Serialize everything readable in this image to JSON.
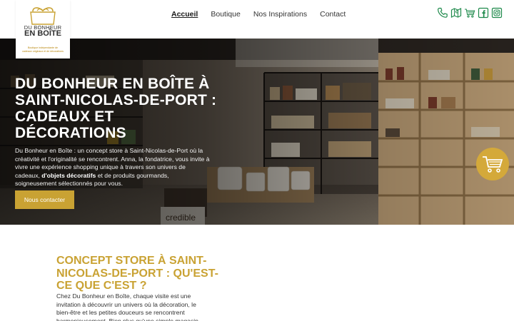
{
  "brand": {
    "logo_line1": "DU BONHEUR",
    "logo_line2": "EN BOÎTE",
    "logo_tagline1": "Boutique indépendante de",
    "logo_tagline2": "cadeaux originaux et de décorations",
    "accent_color": "#c9a233"
  },
  "nav": {
    "items": [
      {
        "label": "Accueil",
        "active": true
      },
      {
        "label": "Boutique",
        "active": false
      },
      {
        "label": "Nos Inspirations",
        "active": false
      },
      {
        "label": "Contact",
        "active": false
      }
    ]
  },
  "header_icons": [
    "phone-icon",
    "map-icon",
    "cart-icon",
    "facebook-icon",
    "instagram-icon"
  ],
  "hero": {
    "title": "DU BONHEUR EN BOÎTE À SAINT-NICOLAS-DE-PORT : CADEAUX ET DÉCORATIONS",
    "text_before": "Du Bonheur en Boîte : un concept store à Saint-Nicolas-de-Port où la créativité et l'originalité se rencontrent. Anna, la fondatrice, vous invite à vivre une expérience shopping unique à travers son univers de cadeaux, ",
    "text_bold": "d'objets décoratifs",
    "text_after": " et de produits gourmands, soigneusement sélectionnés pour vous.",
    "cta_label": "Nous contacter",
    "photo_sign": "credible"
  },
  "concept": {
    "title": "CONCEPT STORE À SAINT-NICOLAS-DE-PORT : QU'EST-CE QUE C'EST ?",
    "text": "Chez Du Bonheur en Boîte, chaque visite est une invitation à découvrir un univers où la décoration, le bien-être et les petites douceurs se rencontrent harmonieusement. Bien plus qu'une simple magasin"
  }
}
